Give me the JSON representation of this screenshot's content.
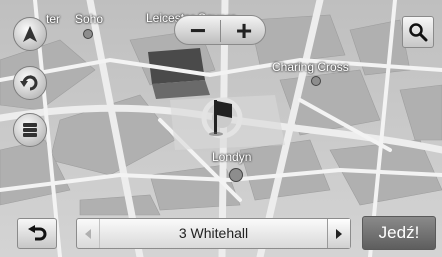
{
  "map": {
    "labels": {
      "soho": "Soho",
      "leicester_square": "Leicester Square",
      "charing_cross": "Charing Cross",
      "london": "Londyn",
      "street_partial": "ter"
    }
  },
  "controls": {
    "zoom_out": "−",
    "zoom_in": "+",
    "search_icon": "search-icon",
    "compass_icon": "compass-north-icon",
    "rotate_icon": "rotate-view-icon",
    "layers_icon": "map-layers-icon"
  },
  "bottom_bar": {
    "back_icon": "back-arrow-icon",
    "address": "3 Whitehall",
    "go_label": "Jedź!"
  },
  "colors": {
    "map_base": "#c9c9c9",
    "block_fill": "#b3b3b3",
    "road": "#ececec",
    "pin": "#222222"
  }
}
